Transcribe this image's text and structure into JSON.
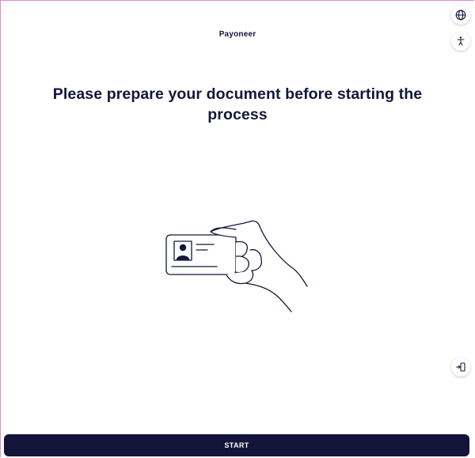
{
  "header": {
    "brand": "Payoneer"
  },
  "main": {
    "heading": "Please prepare your document before starting the process"
  },
  "side_controls": {
    "language_icon": "globe-icon",
    "accessibility_icon": "accessibility-icon",
    "device_switch_icon": "device-switch-icon"
  },
  "footer": {
    "start_label": "START"
  },
  "colors": {
    "text": "#14163a",
    "button_bg": "#13143a",
    "button_text": "#ffffff",
    "frame_border": "#e48ad6"
  }
}
